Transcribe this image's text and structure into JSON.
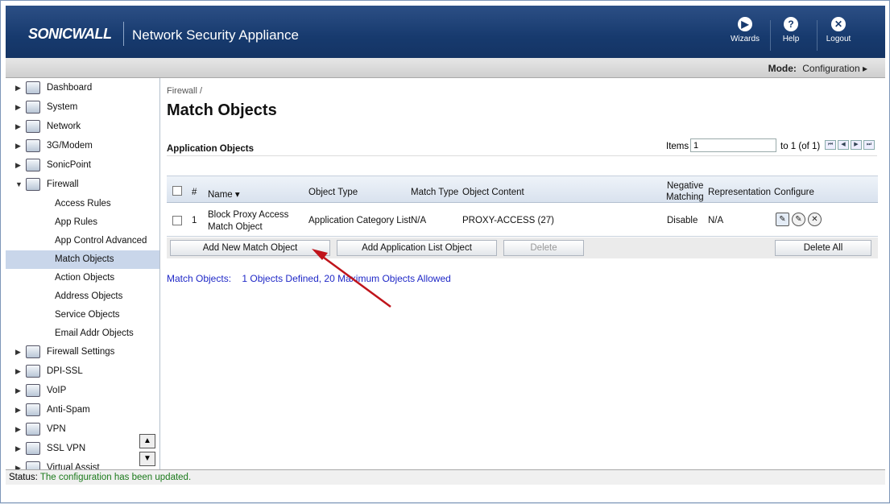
{
  "header": {
    "logo": "SONICWALL",
    "product": "Network Security Appliance",
    "buttons": [
      {
        "label": "Wizards",
        "icon": "wizard-icon",
        "glyph": "▶"
      },
      {
        "label": "Help",
        "icon": "help-icon",
        "glyph": "?"
      },
      {
        "label": "Logout",
        "icon": "logout-icon",
        "glyph": "✕"
      }
    ]
  },
  "modebar": {
    "mode_label": "Mode:",
    "mode_value": "Configuration ▸"
  },
  "sidebar": {
    "items": [
      {
        "label": "Dashboard",
        "arrow": "▶"
      },
      {
        "label": "System",
        "arrow": "▶"
      },
      {
        "label": "Network",
        "arrow": "▶"
      },
      {
        "label": "3G/Modem",
        "arrow": "▶"
      },
      {
        "label": "SonicPoint",
        "arrow": "▶"
      },
      {
        "label": "Firewall",
        "arrow": "▼"
      }
    ],
    "subitems": [
      "Access Rules",
      "App Rules",
      "App Control Advanced",
      "Match Objects",
      "Action Objects",
      "Address Objects",
      "Service Objects",
      "Email Addr Objects"
    ],
    "items2": [
      {
        "label": "Firewall Settings",
        "arrow": "▶"
      },
      {
        "label": "DPI-SSL",
        "arrow": "▶"
      },
      {
        "label": "VoIP",
        "arrow": "▶"
      },
      {
        "label": "Anti-Spam",
        "arrow": "▶"
      },
      {
        "label": "VPN",
        "arrow": "▶"
      },
      {
        "label": "SSL VPN",
        "arrow": "▶"
      },
      {
        "label": "Virtual Assist",
        "arrow": "▶"
      }
    ],
    "scroll_up": "▲",
    "scroll_down": "▼"
  },
  "content": {
    "breadcrumb": "Firewall /",
    "title": "Match Objects",
    "section": "Application Objects",
    "pager": {
      "items_label": "Items",
      "items_value": "1",
      "range": "to 1 (of 1)",
      "buttons": [
        "⏮",
        "◀",
        "▶",
        "⏭"
      ]
    },
    "columns": {
      "num": "#",
      "name": "Name ▾",
      "object_type": "Object Type",
      "match_type": "Match Type",
      "object_content": "Object Content",
      "negative_1": "Negative",
      "negative_2": "Matching",
      "representation": "Representation",
      "configure": "Configure"
    },
    "rows": [
      {
        "num": "1",
        "name_1": "Block Proxy Access",
        "name_2": "Match Object",
        "object_type": "Application Category List",
        "match_type": "N/A",
        "object_content": "PROXY-ACCESS (27)",
        "negative": "Disable",
        "representation": "N/A"
      }
    ],
    "buttons": {
      "add_match": "Add New Match Object",
      "add_app_list": "Add Application List Object",
      "delete": "Delete",
      "delete_all": "Delete All"
    },
    "summary": {
      "label": "Match Objects:",
      "text": "1 Objects Defined, 20 Maximum Objects Allowed"
    }
  },
  "status": {
    "label": "Status:",
    "message": "The configuration has been updated."
  },
  "annotation_color": "#c0141b"
}
